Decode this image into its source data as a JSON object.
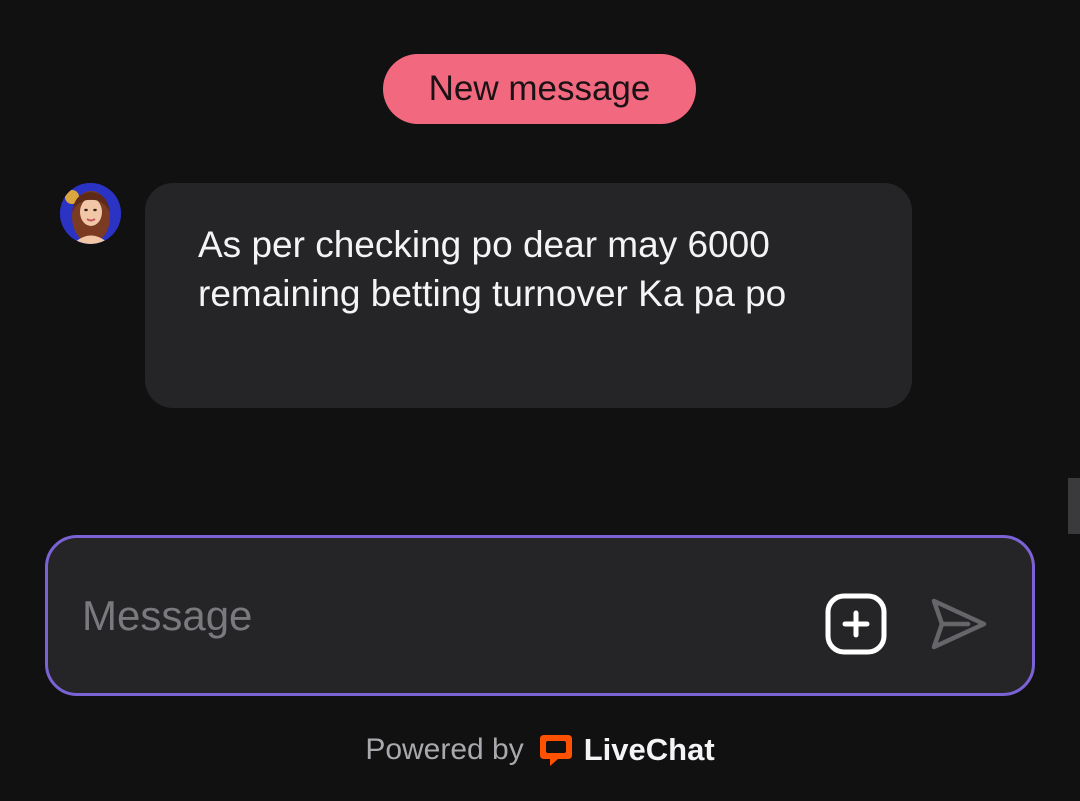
{
  "banner": {
    "new_message_label": "New message"
  },
  "chat": {
    "messages": [
      {
        "sender": "agent",
        "text": "As per checking po dear may 6000 remaining betting turnover Ka pa po"
      }
    ]
  },
  "composer": {
    "placeholder": "Message",
    "attach_icon": "plus-square-icon",
    "send_icon": "send-icon"
  },
  "footer": {
    "powered_by": "Powered by",
    "brand_name": "LiveChat",
    "brand_icon": "livechat-logo-icon"
  },
  "colors": {
    "background": "#111112",
    "pill": "#f2697f",
    "bubble": "#252527",
    "composer_border": "#7b63d6",
    "brand_orange": "#ff5100"
  }
}
